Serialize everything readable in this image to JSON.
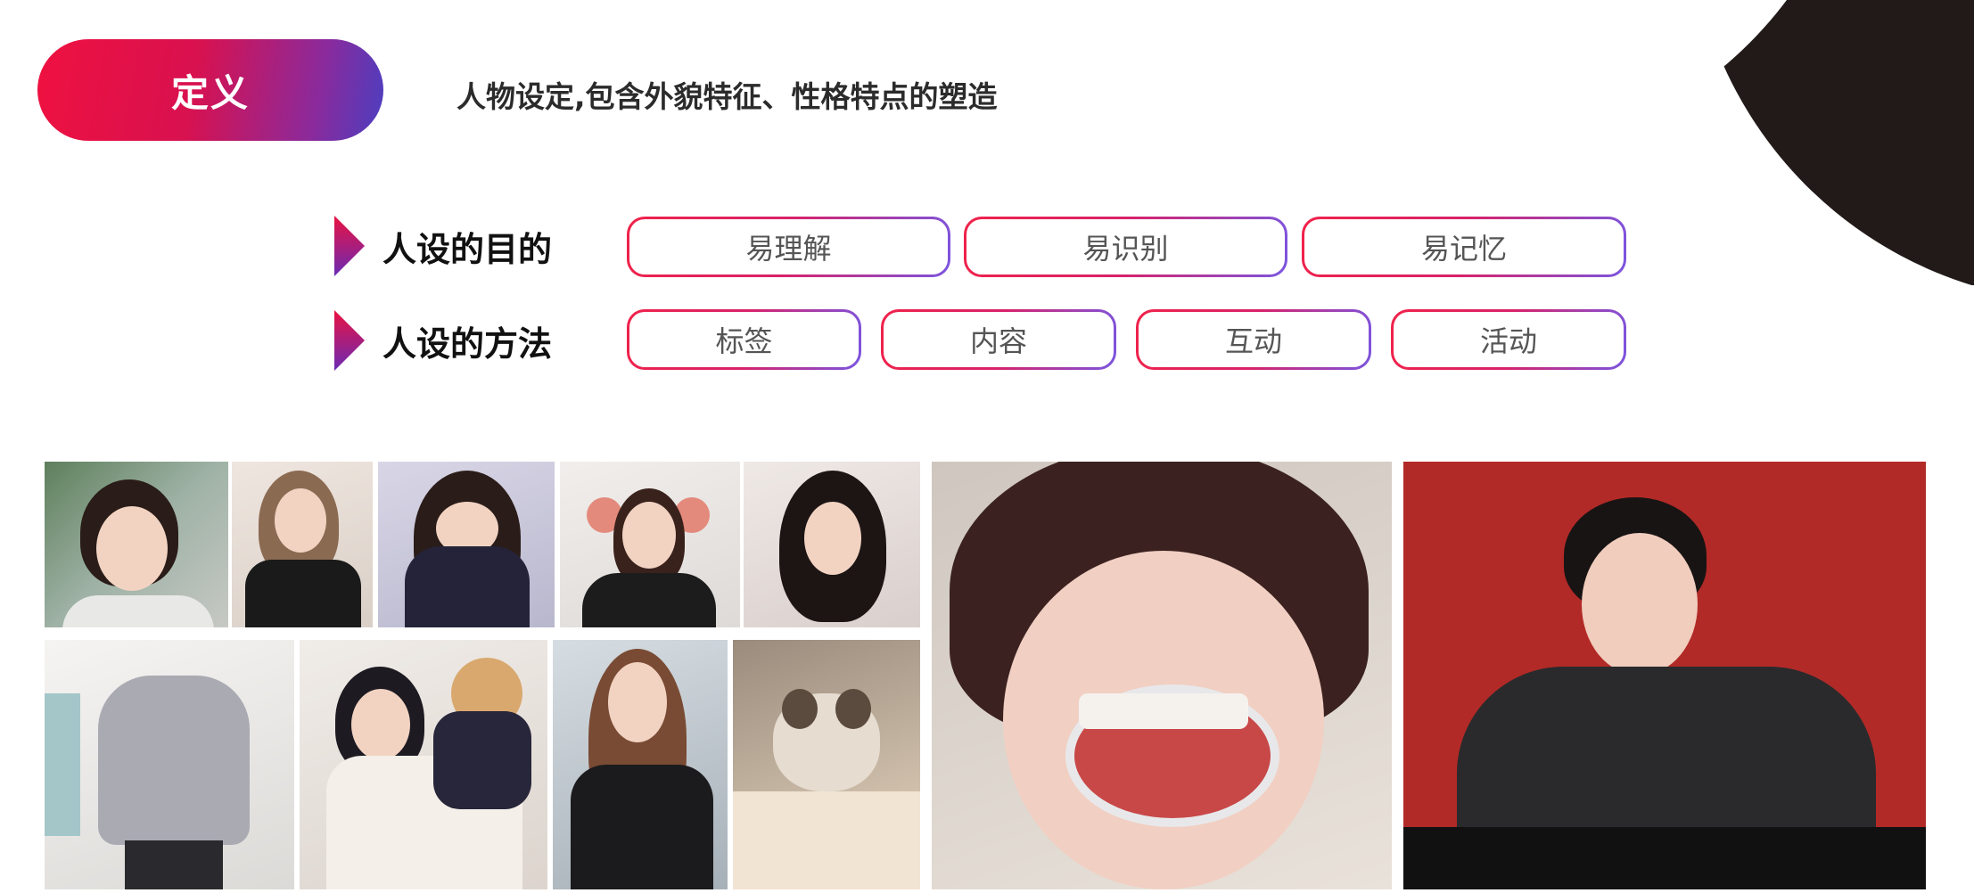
{
  "definition": {
    "badge_label": "定义",
    "text": "人物设定,包含外貌特征、性格特点的塑造"
  },
  "purpose_row": {
    "label": "人设的目的",
    "tags": [
      "易理解",
      "易识别",
      "易记忆"
    ]
  },
  "method_row": {
    "label": "人设的方法",
    "tags": [
      "标签",
      "内容",
      "互动",
      "活动"
    ]
  },
  "photos": [
    {
      "name": "photo-girl-street"
    },
    {
      "name": "photo-girl-overalls"
    },
    {
      "name": "photo-girl-covering-face"
    },
    {
      "name": "photo-girl-ears"
    },
    {
      "name": "photo-girl-hand-on-cheek"
    },
    {
      "name": "photo-girl-sweater"
    },
    {
      "name": "photo-girl-with-cat"
    },
    {
      "name": "photo-girl-leather-jacket"
    },
    {
      "name": "photo-cat"
    },
    {
      "name": "photo-funny-face"
    },
    {
      "name": "photo-man-red-background"
    }
  ],
  "colors": {
    "gradient_start": "#ef1140",
    "gradient_end": "#4c3fc0",
    "dark_accent": "#211a18"
  }
}
